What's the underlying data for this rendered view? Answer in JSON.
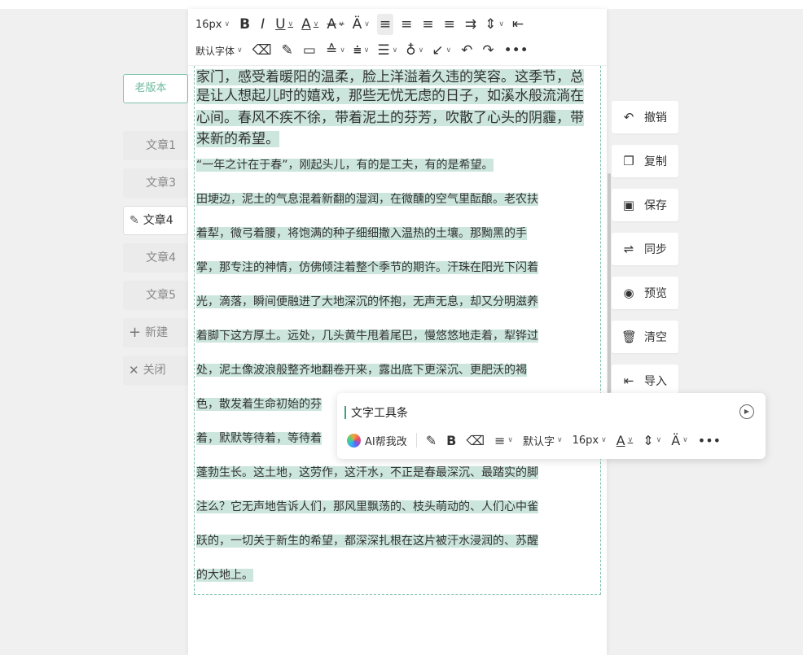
{
  "nav": {
    "old_version": "老版本",
    "items": [
      "文章1",
      "文章3",
      "文章4",
      "文章4",
      "文章5"
    ],
    "new_label": "新建",
    "close_label": "关闭"
  },
  "toolbar": {
    "font_size": "16px",
    "font_family": "默认字体"
  },
  "content": {
    "big_lines": [
      "家门，感受着暖阳的温柔，脸上洋溢着久违的笑容。这季节，总",
      "是让人想起儿时的嬉戏，那些无忧无虑的日子，如溪水般流淌在",
      "心间。春风不疾不徐，带着泥土的芬芳，吹散了心头的阴霾，带",
      "来新的希望。"
    ],
    "small_lines": [
      "“一年之计在于春”，刚起头儿，有的是工夫，有的是希望。",
      "田埂边，泥土的气息混着新翻的湿润，在微醺的空气里酝酿。老农扶",
      "着犁，微弓着腰，将饱满的种子细细撒入温热的土壤。那黝黑的手",
      "掌，那专注的神情，仿佛倾注着整个季节的期许。汗珠在阳光下闪着",
      "光，滴落，瞬间便融进了大地深沉的怀抱，无声无息，却又分明滋养",
      "着脚下这方厚土。远处，几头黄牛甩着尾巴，慢悠悠地走着，犁铧过",
      "处，泥土像波浪般整齐地翻卷开来，露出底下更深沉、更肥沃的褐",
      "色，散发着生命初始的芬",
      "着，默默等待着，等待着",
      "蓬勃生长。这土地，这劳作，这汗水，不正是春最深沉、最踏实的脚",
      "注么？它无声地告诉人们，那风里飘荡的、枝头萌动的、人们心中雀",
      "跃的，一切关于新生的希望，都深深扎根在这片被汗水浸润的、苏醒",
      "的大地上。"
    ]
  },
  "side_buttons": [
    "撤销",
    "复制",
    "保存",
    "同步",
    "预览",
    "清空",
    "导入"
  ],
  "float_toolbar": {
    "title": "文字工具条",
    "ai_label": "AI帮我改",
    "font_family": "默认字",
    "font_size": "16px"
  },
  "colors": {
    "highlight": "#cce6dd",
    "accent": "#3aa57c"
  }
}
